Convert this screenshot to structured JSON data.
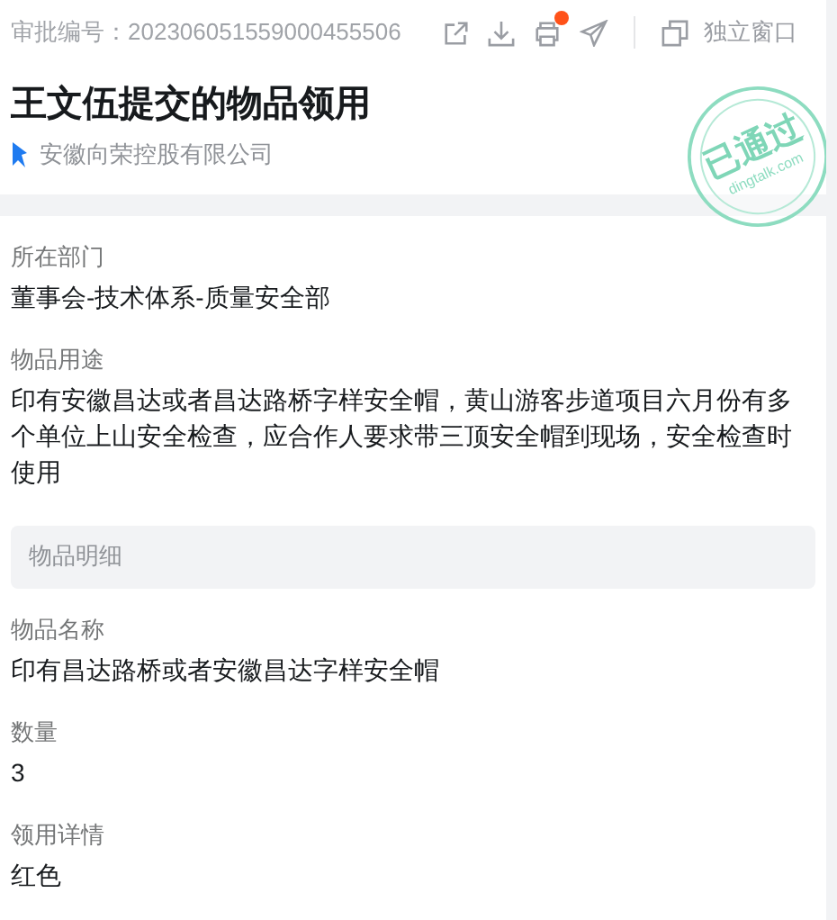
{
  "header": {
    "approval_number": "审批编号：202306051559000455506",
    "notification_badge": true,
    "independent_window": "独立窗口"
  },
  "title": "王文伍提交的物品领用",
  "company": "安徽向荣控股有限公司",
  "stamp": {
    "status": "已通过",
    "site": "dingtalk.com"
  },
  "fields": [
    {
      "label": "所在部门",
      "value": "董事会-技术体系-质量安全部"
    },
    {
      "label": "物品用途",
      "value": "印有安徽昌达或者昌达路桥字样安全帽，黄山游客步道项目六月份有多个单位上山安全检查，应合作人要求带三顶安全帽到现场，安全检查时使用"
    }
  ],
  "detail_section": {
    "title": "物品明细",
    "fields": [
      {
        "label": "物品名称",
        "value": "印有昌达路桥或者安徽昌达字样安全帽"
      },
      {
        "label": "数量",
        "value": "3"
      },
      {
        "label": "领用详情",
        "value": "红色"
      }
    ]
  }
}
